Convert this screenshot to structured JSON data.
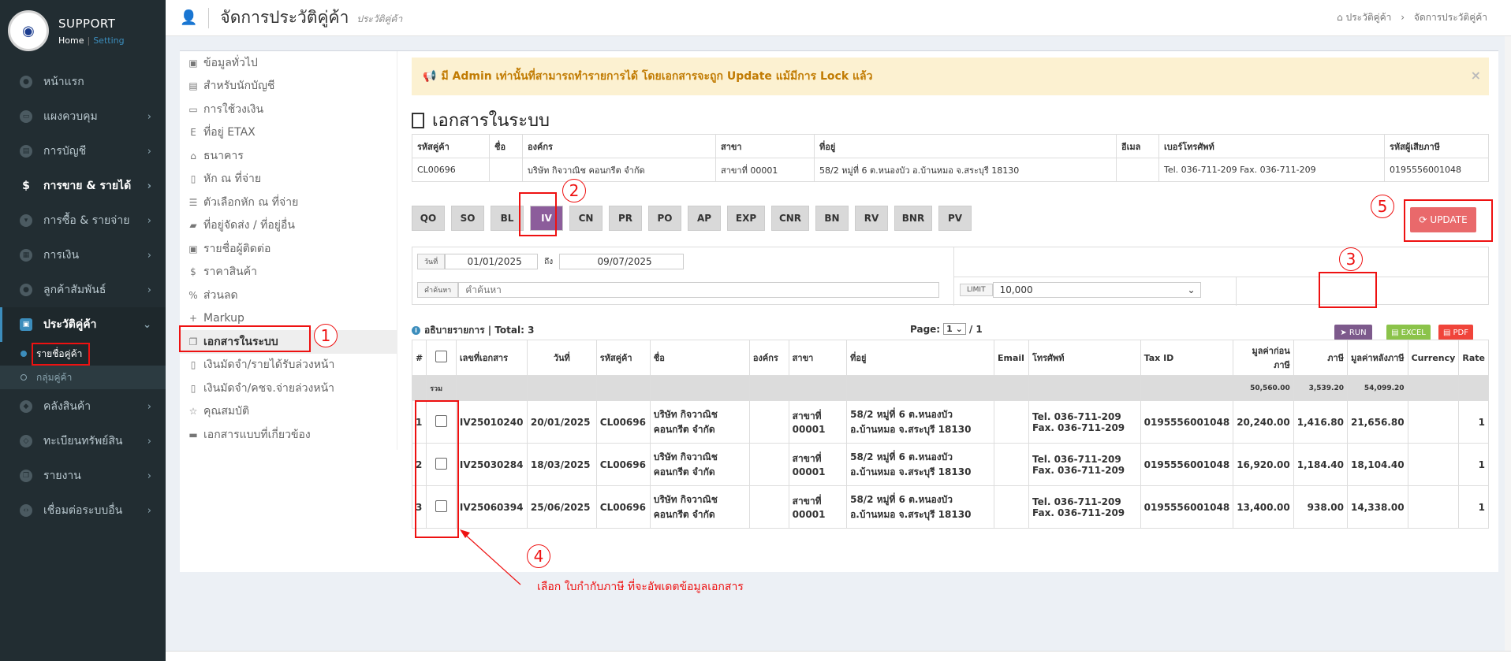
{
  "brand": {
    "title": "SUPPORT",
    "home": "Home",
    "sep": "|",
    "setting": "Setting",
    "logo": "◉"
  },
  "sidebar": {
    "items": [
      {
        "label": "หน้าแรก",
        "icon": "home-icon"
      },
      {
        "label": "แผงควบคุม",
        "icon": "monitor-icon"
      },
      {
        "label": "การบัญชี",
        "icon": "book-icon"
      },
      {
        "label": "การขาย & รายได้",
        "icon": "dollar-icon"
      },
      {
        "label": "การซื้อ & รายจ่าย",
        "icon": "cart-icon"
      },
      {
        "label": "การเงิน",
        "icon": "calendar-icon"
      },
      {
        "label": "ลูกค้าสัมพันธ์",
        "icon": "users-icon"
      },
      {
        "label": "ประวัติคู่ค้า",
        "icon": "contact-icon"
      }
    ],
    "sub_items": [
      {
        "label": "รายชื่อคู่ค้า"
      },
      {
        "label": "กลุ่มคู่ค้า"
      }
    ],
    "items_after": [
      {
        "label": "คลังสินค้า",
        "icon": "cubes-icon"
      },
      {
        "label": "ทะเบียนทรัพย์สิน",
        "icon": "diamond-icon"
      },
      {
        "label": "รายงาน",
        "icon": "copy-icon"
      },
      {
        "label": "เชื่อมต่อระบบอื่น",
        "icon": "code-icon"
      }
    ]
  },
  "header": {
    "title": "จัดการประวัติคู่ค้า",
    "subtitle": "ประวัติคู่ค้า",
    "breadcrumb": [
      "ประวัติคู่ค้า",
      "จัดการประวัติคู่ค้า"
    ]
  },
  "leftnav": [
    "ข้อมูลทั่วไป",
    "สำหรับนักบัญชี",
    "การใช้วงเงิน",
    "ที่อยู่ ETAX",
    "ธนาคาร",
    "หัก ณ ที่จ่าย",
    "ตัวเลือกหัก ณ ที่จ่าย",
    "ที่อยู่จัดส่ง / ที่อยู่อื่น",
    "รายชื่อผู้ติดต่อ",
    "ราคาสินค้า",
    "ส่วนลด",
    "Markup",
    "เอกสารในระบบ",
    "เงินมัดจำ/รายได้รับล่วงหน้า",
    "เงินมัดจำ/คชจ.จ่ายล่วงหน้า",
    "คุณสมบัติ",
    "เอกสารแบบที่เกี่ยวข้อง"
  ],
  "alert": {
    "text": "มี Admin เท่านั้นที่สามารถทำรายการได้ โดยเอกสารจะถูก Update แม้มีการ Lock แล้ว",
    "close": "×"
  },
  "section_title": "เอกสารในระบบ",
  "customer": {
    "headers": [
      "รหัสคู่ค้า",
      "ชื่อ",
      "องค์กร",
      "สาขา",
      "ที่อยู่",
      "อีเมล",
      "เบอร์โทรศัพท์",
      "รหัสผู้เสียภาษี"
    ],
    "values": [
      "CL00696",
      "",
      "บริษัท กิจวาณิช คอนกรีต จำกัด",
      "สาขาที่ 00001",
      "58/2 หมู่ที่ 6 ต.หนองบัว อ.บ้านหมอ จ.สระบุรี 18130",
      "",
      "Tel. 036-711-209 Fax. 036-711-209",
      "0195556001048"
    ]
  },
  "doc_buttons": [
    "QO",
    "SO",
    "BL",
    "IV",
    "CN",
    "PR",
    "PO",
    "AP",
    "EXP",
    "CNR",
    "BN",
    "RV",
    "BNR",
    "PV"
  ],
  "update_label": "UPDATE",
  "filter": {
    "date_label": "วันที่",
    "date_from": "01/01/2025",
    "to_label": "ถึง",
    "date_to": "09/07/2025",
    "search_label": "คำค้นหา",
    "search_placeholder": "คำค้นหา",
    "limit_label": "LIMIT",
    "limit_value": "10,000"
  },
  "actions": {
    "run": "RUN",
    "excel": "EXCEL",
    "pdf": "PDF"
  },
  "list": {
    "title": "อธิบายรายการ | Total: 3",
    "page_label": "Page:",
    "page_value": "1",
    "page_total": "/ 1"
  },
  "table": {
    "headers": [
      "#",
      "",
      "เลขที่เอกสาร",
      "วันที่",
      "รหัสคู่ค้า",
      "ชื่อ",
      "องค์กร",
      "สาขา",
      "ที่อยู่",
      "Email",
      "โทรศัพท์",
      "Tax ID",
      "มูลค่าก่อนภาษี",
      "ภาษี",
      "มูลค่าหลังภาษี",
      "Currency",
      "Rate"
    ],
    "sum": {
      "label": "รวม",
      "before": "50,560.00",
      "tax": "3,539.20",
      "after": "54,099.20"
    },
    "rows": [
      {
        "n": "1",
        "doc": "IV25010240",
        "date": "20/01/2025",
        "code": "CL00696",
        "name": "บริษัท กิจวาณิช คอนกรีต จำกัด",
        "org": "",
        "branch": "สาขาที่ 00001",
        "addr": "58/2 หมู่ที่ 6 ต.หนองบัว อ.บ้านหมอ จ.สระบุรี 18130",
        "email": "",
        "tel": "Tel. 036-711-209 Fax. 036-711-209",
        "tax": "0195556001048",
        "before": "20,240.00",
        "vat": "1,416.80",
        "after": "21,656.80",
        "cur": "",
        "rate": "1"
      },
      {
        "n": "2",
        "doc": "IV25030284",
        "date": "18/03/2025",
        "code": "CL00696",
        "name": "บริษัท กิจวาณิช คอนกรีต จำกัด",
        "org": "",
        "branch": "สาขาที่ 00001",
        "addr": "58/2 หมู่ที่ 6 ต.หนองบัว อ.บ้านหมอ จ.สระบุรี 18130",
        "email": "",
        "tel": "Tel. 036-711-209 Fax. 036-711-209",
        "tax": "0195556001048",
        "before": "16,920.00",
        "vat": "1,184.40",
        "after": "18,104.40",
        "cur": "",
        "rate": "1"
      },
      {
        "n": "3",
        "doc": "IV25060394",
        "date": "25/06/2025",
        "code": "CL00696",
        "name": "บริษัท กิจวาณิช คอนกรีต จำกัด",
        "org": "",
        "branch": "สาขาที่ 00001",
        "addr": "58/2 หมู่ที่ 6 ต.หนองบัว อ.บ้านหมอ จ.สระบุรี 18130",
        "email": "",
        "tel": "Tel. 036-711-209 Fax. 036-711-209",
        "tax": "0195556001048",
        "before": "13,400.00",
        "vat": "938.00",
        "after": "14,338.00",
        "cur": "",
        "rate": "1"
      }
    ]
  },
  "annotations": {
    "n1": "1",
    "n2": "2",
    "n3": "3",
    "n4": "4",
    "n5": "5",
    "note": "เลือก ใบกำกับภาษี ที่จะอัพเดตข้อมูลเอกสาร"
  },
  "colors": {
    "sidebar": "#222d32",
    "accent": "#3c8dbc",
    "active_doc": "#8c5d9b",
    "update": "#e9696b",
    "annotation": "#ee1111"
  }
}
